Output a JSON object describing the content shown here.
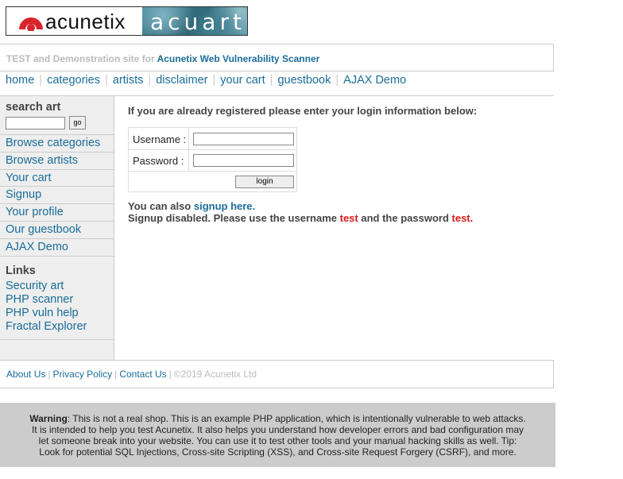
{
  "logo": {
    "brand": "acunetix",
    "product": "acuart"
  },
  "tagline": {
    "prefix": "TEST and Demonstration site for",
    "link": "Acunetix Web Vulnerability Scanner"
  },
  "nav": {
    "items": [
      "home",
      "categories",
      "artists",
      "disclaimer",
      "your cart",
      "guestbook",
      "AJAX Demo"
    ],
    "separator": "|"
  },
  "sidebar": {
    "search_title": "search art",
    "search_button": "go",
    "items": [
      "Browse categories",
      "Browse artists",
      "Your cart",
      "Signup",
      "Your profile",
      "Our guestbook",
      "AJAX Demo"
    ],
    "links_title": "Links",
    "links": [
      "Security art",
      "PHP scanner",
      "PHP vuln help",
      "Fractal Explorer"
    ]
  },
  "main": {
    "intro": "If you are already registered please enter your login information below:",
    "username_label": "Username :",
    "password_label": "Password :",
    "login_button": "login",
    "signup_prefix": "You can also",
    "signup_link": "signup here.",
    "disabled_1": "Signup disabled. Please use the username",
    "disabled_user": "test",
    "disabled_2": "and the password",
    "disabled_pass": "test",
    "disabled_end": "."
  },
  "footer": {
    "links": [
      "About Us",
      "Privacy Policy",
      "Contact Us"
    ],
    "separator": "|",
    "copyright": "©2019 Acunetix Ltd"
  },
  "warning": {
    "label": "Warning",
    "line1": ": This is not a real shop. This is an example PHP application, which is intentionally vulnerable to web attacks.",
    "line2": "It is intended to help you test Acunetix. It also helps you understand how developer errors and bad configuration may",
    "line3": "let someone break into your website. You can use it to test other tools and your manual hacking skills as well. Tip:",
    "line4": "Look for potential SQL Injections, Cross-site Scripting (XSS), and Cross-site Request Forgery (CSRF), and more."
  },
  "colors": {
    "link": "#1a6d9a",
    "highlight": "#d91a1a",
    "sidebar_bg": "#eeeeee",
    "warning_bg": "#cccccc"
  }
}
